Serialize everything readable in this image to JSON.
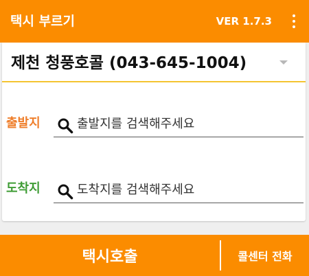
{
  "app": {
    "title": "택시 부르기",
    "version": "VER 1.7.3",
    "menu_icon": "overflow-menu-icon"
  },
  "call_center": {
    "selected": "제천 청풍호콜 (043-645-1004)"
  },
  "origin": {
    "label": "출발지",
    "placeholder": "출발지를 검색해주세요",
    "value": "",
    "label_color": "#ef7f2c"
  },
  "destination": {
    "label": "도착지",
    "placeholder": "도착지를 검색해주세요",
    "value": "",
    "label_color": "#3f9c35"
  },
  "bottom": {
    "call_label": "택시호출",
    "center_label": "콜센터 전화"
  },
  "colors": {
    "accent": "#fb8c00",
    "spinner_underline": "#f4c430",
    "background": "#efefef"
  }
}
